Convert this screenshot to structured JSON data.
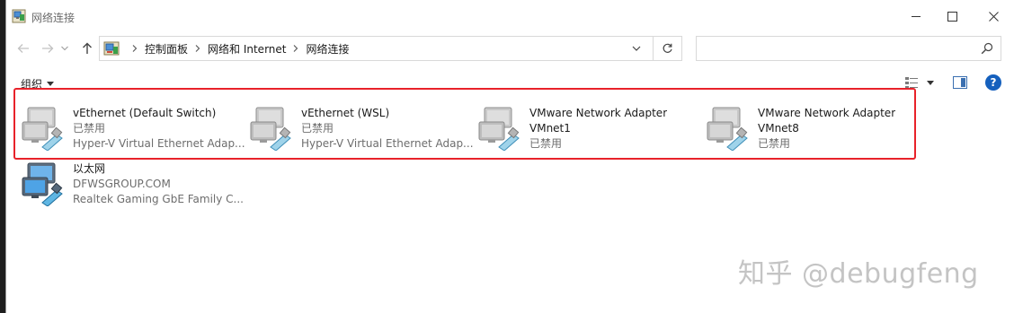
{
  "window": {
    "title": "网络连接",
    "icon": "network-connections-icon"
  },
  "address_bar": {
    "crumbs": [
      "控制面板",
      "网络和 Internet",
      "网络连接"
    ]
  },
  "search": {
    "placeholder": ""
  },
  "command_bar": {
    "organize_label": "组织",
    "help_label": "?"
  },
  "connections": [
    {
      "name": "vEthernet (Default Switch)",
      "status": "已禁用",
      "adapter": "Hyper-V Virtual Ethernet Adap...",
      "state": "disabled"
    },
    {
      "name": "vEthernet (WSL)",
      "status": "已禁用",
      "adapter": "Hyper-V Virtual Ethernet Adap...",
      "state": "disabled"
    },
    {
      "name": "VMware Network Adapter",
      "name2": "VMnet1",
      "status": "已禁用",
      "state": "disabled"
    },
    {
      "name": "VMware Network Adapter",
      "name2": "VMnet8",
      "status": "已禁用",
      "state": "disabled"
    },
    {
      "name": "以太网",
      "status": "DFWSGROUP.COM",
      "adapter": "Realtek Gaming GbE Family C...",
      "state": "connected"
    }
  ],
  "colors": {
    "highlight_border": "#e8222a",
    "help_blue": "#1560bd"
  },
  "watermark": "知乎 @debugfeng"
}
